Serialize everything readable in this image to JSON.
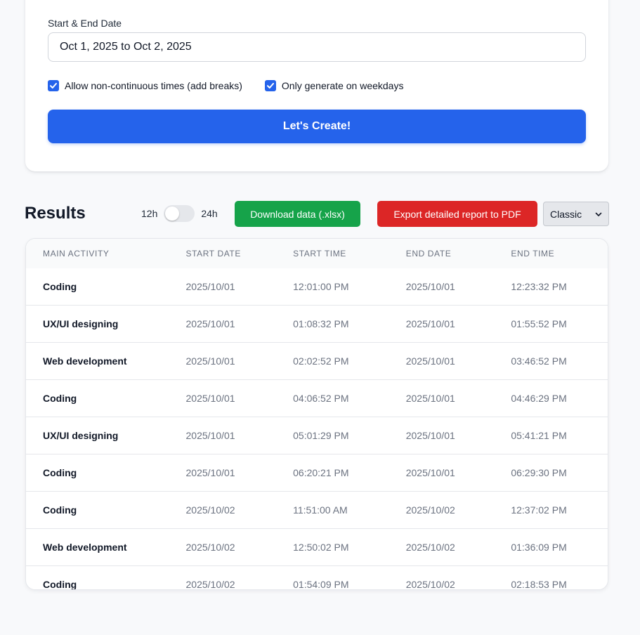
{
  "form": {
    "date_label": "Start & End Date",
    "date_value": "Oct 1, 2025 to Oct 2, 2025",
    "checkbox_breaks_label": "Allow non-continuous times (add breaks)",
    "checkbox_weekdays_label": "Only generate on weekdays",
    "checkbox_breaks_checked": true,
    "checkbox_weekdays_checked": true,
    "create_button": "Let's Create!"
  },
  "results": {
    "title": "Results",
    "toggle_left": "12h",
    "toggle_right": "24h",
    "download_button": "Download data (.xlsx)",
    "export_button": "Export detailed report to PDF",
    "theme_select": "Classic"
  },
  "table": {
    "headers": [
      "Main Activity",
      "Start Date",
      "Start Time",
      "End Date",
      "End Time"
    ],
    "rows": [
      [
        "Coding",
        "2025/10/01",
        "12:01:00 PM",
        "2025/10/01",
        "12:23:32 PM"
      ],
      [
        "UX/UI designing",
        "2025/10/01",
        "01:08:32 PM",
        "2025/10/01",
        "01:55:52 PM"
      ],
      [
        "Web development",
        "2025/10/01",
        "02:02:52 PM",
        "2025/10/01",
        "03:46:52 PM"
      ],
      [
        "Coding",
        "2025/10/01",
        "04:06:52 PM",
        "2025/10/01",
        "04:46:29 PM"
      ],
      [
        "UX/UI designing",
        "2025/10/01",
        "05:01:29 PM",
        "2025/10/01",
        "05:41:21 PM"
      ],
      [
        "Coding",
        "2025/10/01",
        "06:20:21 PM",
        "2025/10/01",
        "06:29:30 PM"
      ],
      [
        "Coding",
        "2025/10/02",
        "11:51:00 AM",
        "2025/10/02",
        "12:37:02 PM"
      ],
      [
        "Web development",
        "2025/10/02",
        "12:50:02 PM",
        "2025/10/02",
        "01:36:09 PM"
      ],
      [
        "Coding",
        "2025/10/02",
        "01:54:09 PM",
        "2025/10/02",
        "02:18:53 PM"
      ]
    ]
  },
  "colors": {
    "primary": "#2563eb",
    "success": "#16a34a",
    "danger": "#dc2626"
  }
}
